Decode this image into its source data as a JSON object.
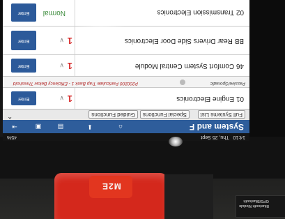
{
  "status_bar": {
    "time": "14:10",
    "date": "Thu, 25 Sept",
    "battery": "45%"
  },
  "title": "System and F",
  "toolbar_icons": [
    "home-icon",
    "download-icon",
    "print-icon",
    "screenshot-icon",
    "exit-icon"
  ],
  "tabs": [
    "Full Systems List",
    "Special Functions",
    "Guided Functions"
  ],
  "systems": [
    {
      "name": "01 Engine Electronics",
      "fault_count": "1",
      "button": "Enter"
    },
    {
      "name": "46 Comfort System Central Module",
      "fault_count": "1",
      "button": "Enter"
    },
    {
      "name": "BB Rear Drivers Side Door Electronics",
      "fault_count": "1",
      "button": "Enter"
    },
    {
      "name": "02 Transmission Electronics",
      "status": "Normal",
      "button": "Enter"
    }
  ],
  "dtc": {
    "code_text": "P200200 Particulate Trap Bank 1 - Efficiency Below Threshold",
    "status_text": "Passive/Sporadic"
  },
  "device": {
    "logo": "M2E"
  },
  "sticker": {
    "line1": "Bluetooth Module",
    "line2": "GPS/Bluetooth"
  },
  "colors": {
    "title_bar": "#2e5d9b",
    "fault": "#d42020",
    "normal": "#3a8a3a",
    "enter_button": "#2c5a9a",
    "handle": "#d4281c"
  }
}
